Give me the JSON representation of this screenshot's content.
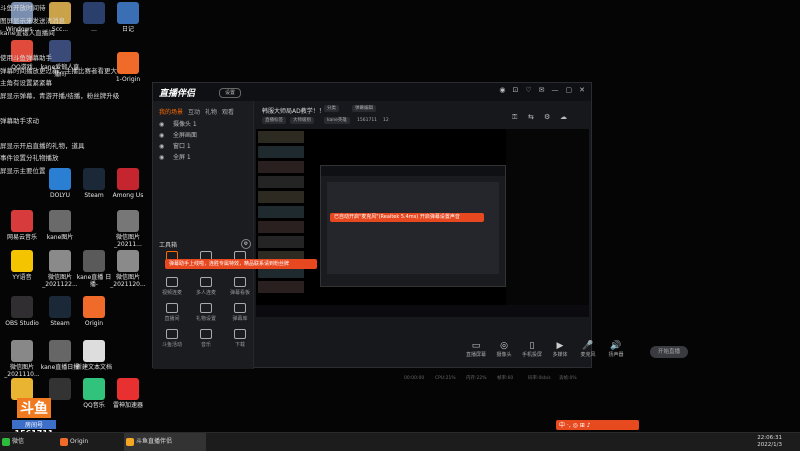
{
  "desktop": {
    "icons": [
      {
        "label": "Windows...",
        "color": "#7a8fb0"
      },
      {
        "label": "Scc...",
        "color": "#c9a24a"
      },
      {
        "label": "...",
        "color": "#2a3f6b"
      },
      {
        "label": "日记",
        "color": "#3a6fb5"
      },
      {
        "label": "QQ游戏",
        "color": "#e04b3c"
      },
      {
        "label": "kane爱锻人直播间",
        "color": "#3a4b7a"
      },
      {
        "label": "1-Origin",
        "color": "#f06a2a"
      },
      {
        "label": "DOLYU",
        "color": "#2b7fd3"
      },
      {
        "label": "Steam",
        "color": "#1b2838"
      },
      {
        "label": "Among Us",
        "color": "#c5252f"
      },
      {
        "label": "网易云音乐",
        "color": "#d83b3b"
      },
      {
        "label": "kane图片",
        "color": "#6a6a6a"
      },
      {
        "label": "微信图片_20211...",
        "color": "#777777"
      },
      {
        "label": "YY语音",
        "color": "#f5c400"
      },
      {
        "label": "微信图片_2021122...",
        "color": "#8a8a8a"
      },
      {
        "label": "kane直播 日播-",
        "color": "#5a5a5a"
      },
      {
        "label": "微信图片_2021120...",
        "color": "#8a8a8a"
      },
      {
        "label": "OBS Studio",
        "color": "#302e31"
      },
      {
        "label": "Steam",
        "color": "#1b2838"
      },
      {
        "label": "Origin",
        "color": "#f06a2a"
      },
      {
        "label": "微信图片_2021110...",
        "color": "#888888"
      },
      {
        "label": "kane直播日报",
        "color": "#666666"
      },
      {
        "label": "新建文本文档",
        "color": "#dddddd"
      },
      {
        "label": "",
        "color": "#e8b432"
      },
      {
        "label": "",
        "color": "#333333"
      },
      {
        "label": "QQ音乐",
        "color": "#31c27c"
      },
      {
        "label": "雷神加速器",
        "color": "#e83030"
      }
    ],
    "overlay_lines": [
      "斗鱼开放时间待",
      "图屏显示来发送消消息",
      "kane爱锻人直播间",
      "",
      "使用斗鱼弹幕助手",
      "弹幕时间播放更过新，主播比赛者看更大",
      "主角有设置紧紧幕",
      "屏显示弹幕，青游开播/结播，粉丝牌升级",
      "",
      "弹幕助手求动",
      "",
      "屏显示开启直播的礼物，道具",
      "事件设置分礼物播放",
      "屏显示主要位置"
    ],
    "room_logo_text": "斗鱼",
    "room_label": "房间号",
    "room_number": "1561711"
  },
  "app": {
    "title": "直播伴侣",
    "badge": "设置",
    "window_controls": [
      "◉",
      "⊡",
      "♡",
      "✉",
      "—",
      "▢",
      "✕"
    ],
    "left_tabs": [
      "我的场景",
      "互动",
      "礼物",
      "观看"
    ],
    "scenes": [
      "摄像头 1",
      "全屏画面",
      "窗口 1",
      "全屏 1"
    ],
    "tools_title": "工具箱",
    "tools": [
      "主播",
      "粉丝",
      "任务",
      "视频连麦",
      "多人连麦",
      "弹幕看板",
      "直播间",
      "礼物设置",
      "弹幕库",
      "斗鱼活动",
      "音乐",
      "下载"
    ],
    "room_title": "韩服大师局AD教学！！",
    "room_pills": [
      "分类",
      "弹幕编辑",
      "直播标签",
      "大师级别",
      "kane英雄",
      "1561711",
      "12"
    ],
    "top_icons": [
      "⚿",
      "⇆",
      "⚙",
      "☁"
    ],
    "toast_main": "已自动开启\"麦克风\"(Realtek 5.4ms) 开启弹幕设置声音",
    "toast_bottom": "弹幕助手上线啦，连胜专属特效，精品联系请到粉丝牌",
    "controls": [
      "直播屏幕",
      "摄像头",
      "手机投屏",
      "多媒体",
      "麦克风",
      "扬声器"
    ],
    "start_button": "开始直播",
    "status": [
      "00:00:00",
      "CPU:21%",
      "内存:22%",
      "帧率:60",
      "码率:0kb/s",
      "丢帧:0%"
    ]
  },
  "taskbar": {
    "items": [
      "微信",
      "Origin",
      "斗鱼直播伴侣"
    ],
    "tray_text": "中 ·, ◎ ⊞ ♪",
    "time": "22:06:31",
    "date": "2022/1/3"
  }
}
